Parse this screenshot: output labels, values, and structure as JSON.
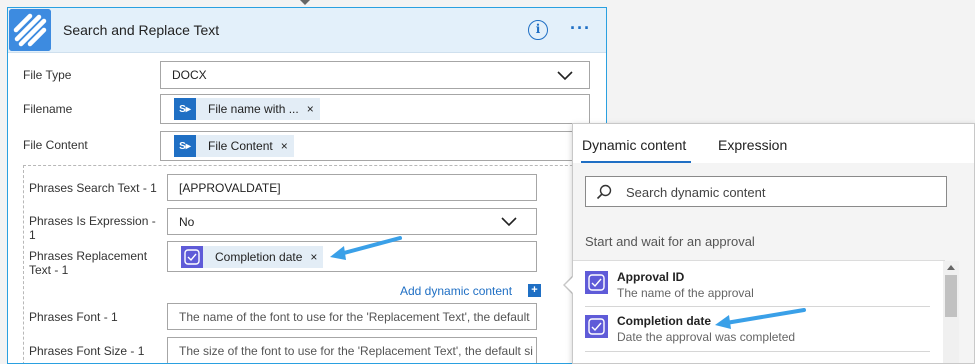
{
  "card": {
    "title": "Search and Replace Text",
    "icon_name": "encodian-logo-icon",
    "info_icon": "info-icon",
    "more_icon": "more-options-icon"
  },
  "fields": {
    "file_type": {
      "label": "File Type",
      "value": "DOCX"
    },
    "filename": {
      "label": "Filename",
      "token": "File name with ..."
    },
    "file_content": {
      "label": "File Content",
      "token": "File Content"
    },
    "phrases_search_text": {
      "label": "Phrases Search Text - 1",
      "value": "[APPROVALDATE]"
    },
    "phrases_is_expression": {
      "label_line1": "Phrases Is Expression -",
      "label_line2": "1",
      "value": "No"
    },
    "phrases_replacement_text": {
      "label_line1": "Phrases Replacement",
      "label_line2": "Text - 1",
      "token": "Completion date"
    },
    "phrases_font": {
      "label": "Phrases Font - 1",
      "placeholder": "The name of the font to use for the 'Replacement Text', the default"
    },
    "phrases_font_size": {
      "label": "Phrases Font Size - 1",
      "placeholder": "The size of the font to use for the 'Replacement Text', the default si"
    }
  },
  "add_dynamic_content": "Add dynamic content",
  "add_dynamic_plus": "+",
  "token_close": "×",
  "panel": {
    "tabs": [
      "Dynamic content",
      "Expression"
    ],
    "active_tab": "Dynamic content",
    "search_placeholder": "Search dynamic content",
    "section": "Start and wait for an approval",
    "items": [
      {
        "title": "Approval ID",
        "description": "The name of the approval"
      },
      {
        "title": "Completion date",
        "description": "Date the approval was completed"
      }
    ]
  },
  "colors": {
    "accent": "#1f6fc4",
    "card_border": "#2aa0e0",
    "header_bg": "#e3f0fa",
    "approval_icon": "#5f5bd8",
    "annotation_arrow": "#3aa0e8"
  }
}
